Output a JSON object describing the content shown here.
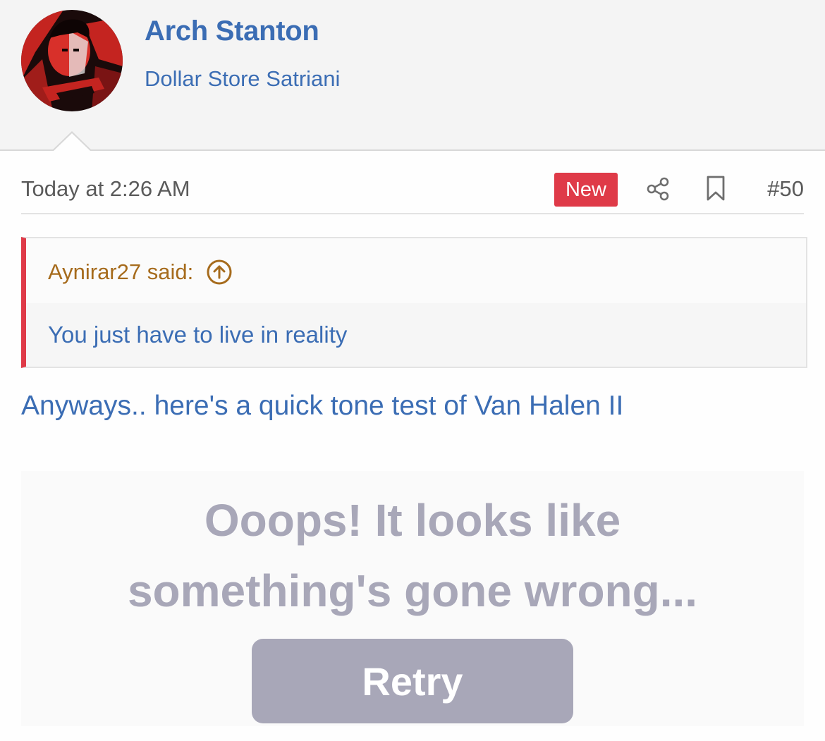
{
  "user": {
    "name": "Arch Stanton",
    "title": "Dollar Store Satriani"
  },
  "post": {
    "date": "Today at 2:26 AM",
    "badge": "New",
    "number": "#50",
    "quote": {
      "author_label": "Aynirar27 said:",
      "text": "You just have to live in reality"
    },
    "body": "Anyways.. here's a quick tone test of Van Halen II"
  },
  "embed": {
    "error_line1": "Ooops! It looks like",
    "error_line2": "something's gone wrong...",
    "retry_label": "Retry"
  },
  "colors": {
    "link": "#3b6db4",
    "badge": "#df3a48",
    "quote_author": "#a66b1c",
    "error_text": "#a8a7b8"
  },
  "icons": {
    "share": "share-icon",
    "bookmark": "bookmark-icon",
    "quote_jump": "arrow-up-circle-icon"
  }
}
